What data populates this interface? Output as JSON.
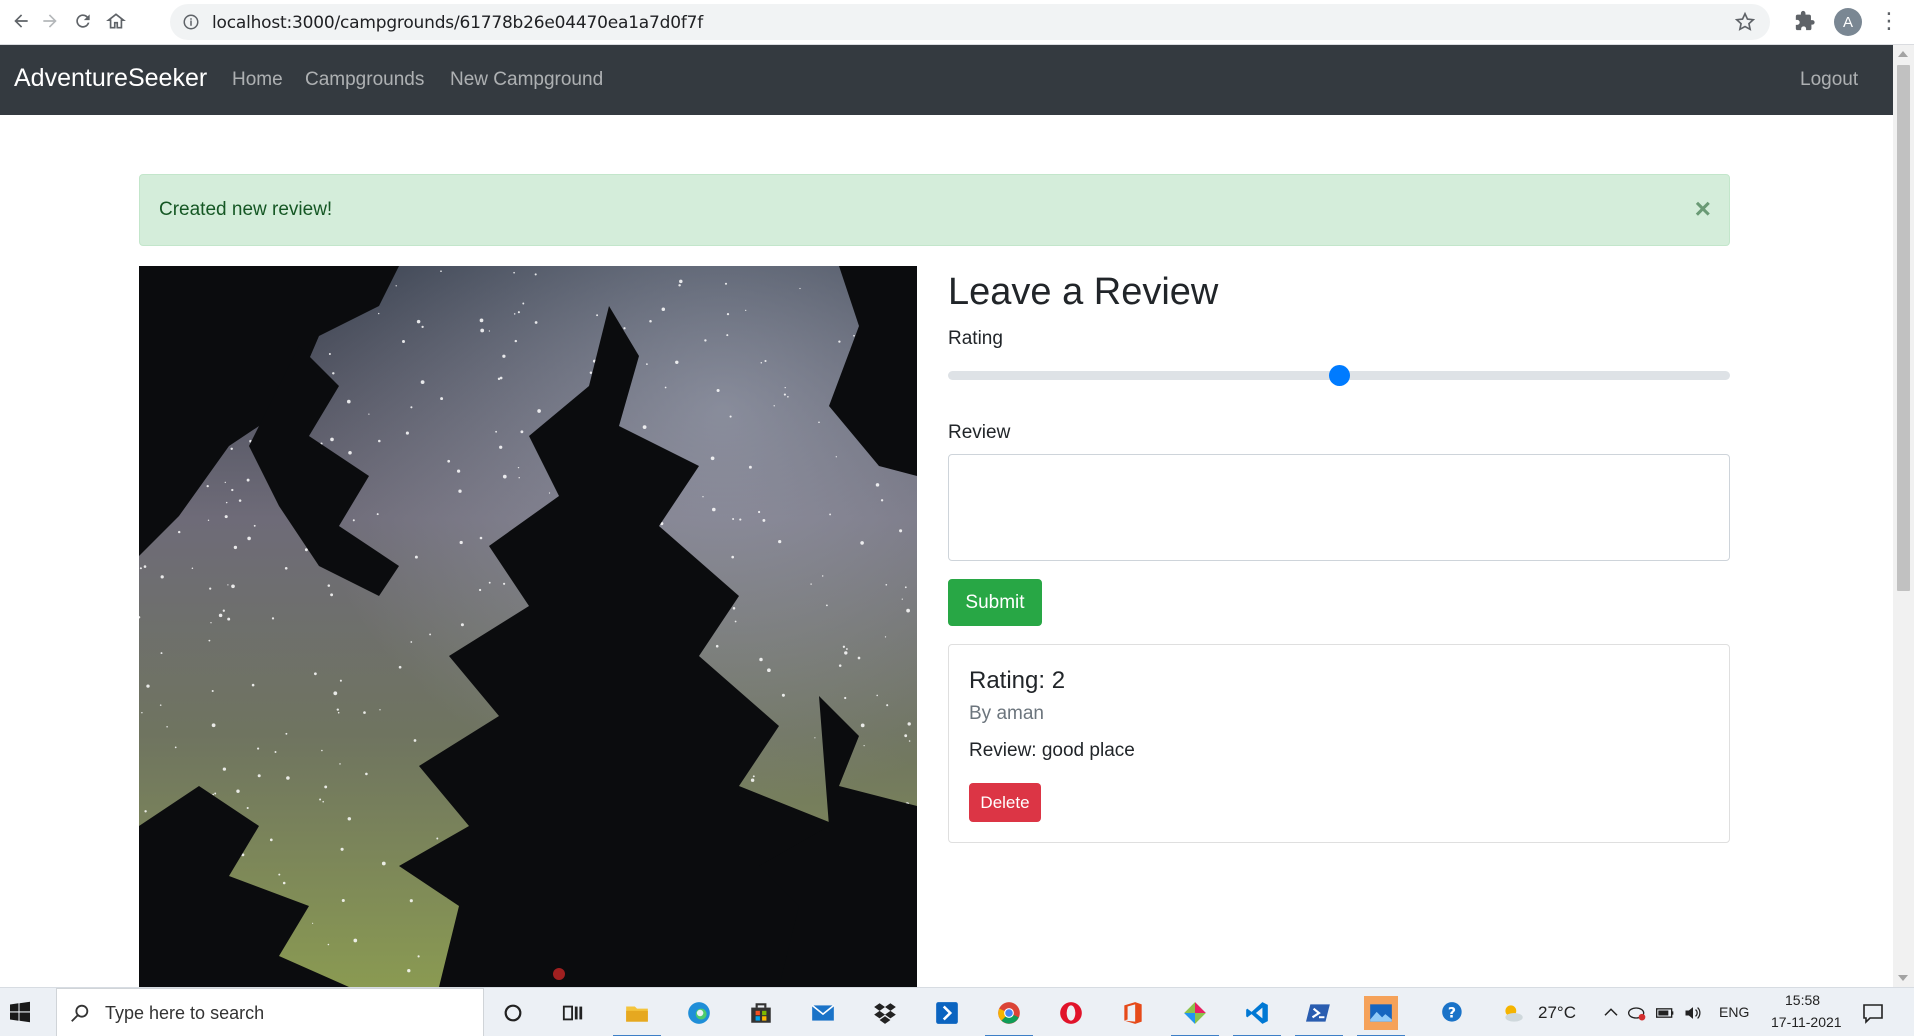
{
  "browser": {
    "url": "localhost:3000/campgrounds/61778b26e04470ea1a7d0f7f",
    "profile_initial": "A",
    "icons": [
      "back-icon",
      "forward-icon",
      "reload-icon",
      "home-icon",
      "info-icon",
      "star-icon",
      "extensions-icon",
      "menu-icon"
    ]
  },
  "navbar": {
    "brand": "AdventureSeeker",
    "links": [
      "Home",
      "Campgrounds",
      "New Campground"
    ],
    "logout": "Logout",
    "bg_color": "#343a40"
  },
  "alert": {
    "message": "Created new review!",
    "close": "×",
    "color": "#d4edda"
  },
  "review_form": {
    "heading": "Leave a Review",
    "rating_label": "Rating",
    "rating_value_fraction": 0.5,
    "review_label": "Review",
    "review_value": "",
    "submit": "Submit",
    "submit_color": "#28a745"
  },
  "reviews": [
    {
      "title": "Rating: 2",
      "author": "By aman",
      "text": "Review: good place",
      "delete": "Delete",
      "delete_color": "#dc3545"
    }
  ],
  "taskbar": {
    "search_placeholder": "Type here to search",
    "weather": "27°C",
    "language": "ENG",
    "time": "15:58",
    "date": "17-11-2021"
  }
}
